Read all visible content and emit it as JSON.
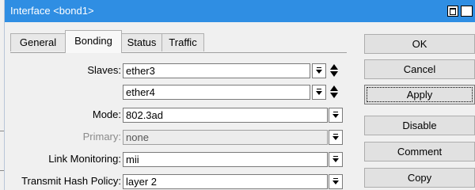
{
  "window": {
    "title": "Interface <bond1>"
  },
  "tabs": [
    {
      "label": "General",
      "active": false
    },
    {
      "label": "Bonding",
      "active": true
    },
    {
      "label": "Status",
      "active": false
    },
    {
      "label": "Traffic",
      "active": false
    }
  ],
  "form": {
    "slaves_label": "Slaves:",
    "slaves": [
      "ether3",
      "ether4"
    ],
    "mode_label": "Mode:",
    "mode_value": "802.3ad",
    "primary_label": "Primary:",
    "primary_value": "none",
    "link_monitoring_label": "Link Monitoring:",
    "link_monitoring_value": "mii",
    "transmit_hash_policy_label": "Transmit Hash Policy:",
    "transmit_hash_policy_value": "layer 2"
  },
  "buttons": {
    "ok": "OK",
    "cancel": "Cancel",
    "apply": "Apply",
    "disable": "Disable",
    "comment": "Comment",
    "copy": "Copy"
  },
  "colors": {
    "titlebar": "#2f8ee3"
  },
  "icons": [
    "maximize-icon",
    "close-icon",
    "dropdown-icon",
    "up-arrow-icon",
    "down-arrow-icon"
  ]
}
